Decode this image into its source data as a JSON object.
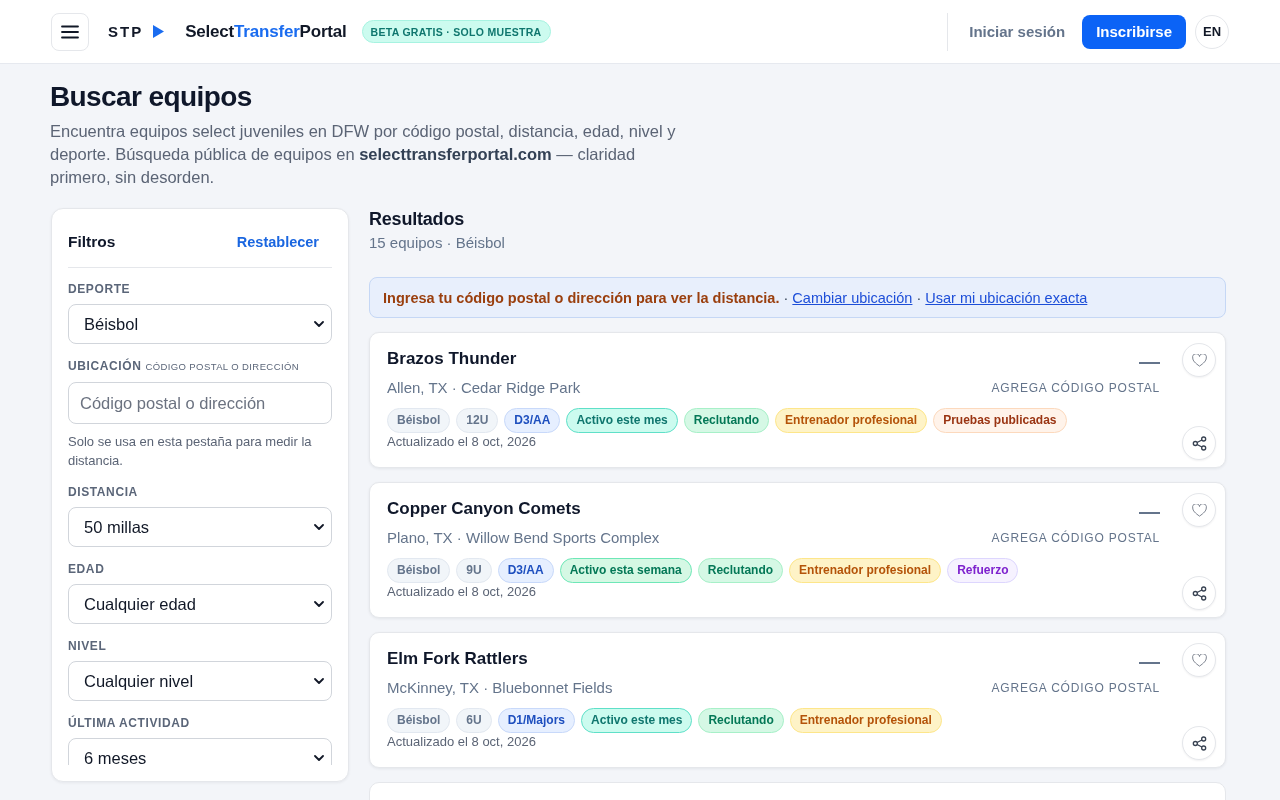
{
  "header": {
    "brand": {
      "abbr": "STP",
      "name_parts": [
        {
          "text": "Select",
          "accent": false
        },
        {
          "text": "Transfer",
          "accent": true
        },
        {
          "text": "Portal",
          "accent": false
        }
      ]
    },
    "badge": "BETA GRATIS · SOLO MUESTRA",
    "sign_in": "Iniciar sesión",
    "sign_up": "Inscribirse",
    "language": "EN"
  },
  "page": {
    "title": "Buscar equipos",
    "description": "Encuentra equipos select juveniles en DFW por código postal, distancia, edad, nivel y deporte. Búsqueda pública de equipos en **selecttransferportal.com** — claridad primero, sin desorden."
  },
  "filters": {
    "title": "Filtros",
    "reset": "Restablecer",
    "fields": [
      {
        "kind": "select",
        "label": "DEPORTE",
        "value": "Béisbol"
      },
      {
        "kind": "input",
        "label": "UBICACIÓN",
        "sublabel": "CÓDIGO POSTAL O DIRECCIÓN",
        "placeholder": "Código postal o dirección",
        "help": "Solo se usa en esta pestaña para medir la distancia."
      },
      {
        "kind": "select",
        "label": "DISTANCIA",
        "value": "50 millas"
      },
      {
        "kind": "select",
        "label": "EDAD",
        "value": "Cualquier edad"
      },
      {
        "kind": "select",
        "label": "NIVEL",
        "value": "Cualquier nivel"
      },
      {
        "kind": "select",
        "label": "ÚLTIMA ACTIVIDAD",
        "value": "6 meses"
      }
    ]
  },
  "results": {
    "title": "Resultados",
    "summary": "15 equipos · Béisbol",
    "notice": {
      "message": "Ingresa tu código postal o dirección para ver la distancia.",
      "separator": "·",
      "links": [
        "Cambiar ubicación",
        "Usar mi ubicación exacta"
      ]
    },
    "cards": [
      {
        "name": "Brazos Thunder",
        "location": "Allen, TX · Cedar Ridge Park",
        "distance": "—",
        "distance_note": "AGREGA CÓDIGO POSTAL",
        "saved": false,
        "tags": [
          {
            "label": "Béisbol",
            "kind": "sport"
          },
          {
            "label": "12U",
            "kind": "age"
          },
          {
            "label": "D3/AA",
            "kind": "level"
          },
          {
            "label": "Activo este mes",
            "kind": "active-month"
          },
          {
            "label": "Reclutando",
            "kind": "recruiting"
          },
          {
            "label": "Entrenador profesional",
            "kind": "coach"
          },
          {
            "label": "Pruebas publicadas",
            "kind": "tryouts"
          }
        ],
        "updated": "Actualizado el 8 oct, 2026"
      },
      {
        "name": "Copper Canyon Comets",
        "location": "Plano, TX · Willow Bend Sports Complex",
        "distance": "—",
        "distance_note": "AGREGA CÓDIGO POSTAL",
        "saved": false,
        "tags": [
          {
            "label": "Béisbol",
            "kind": "sport"
          },
          {
            "label": "9U",
            "kind": "age"
          },
          {
            "label": "D3/AA",
            "kind": "level"
          },
          {
            "label": "Activo esta semana",
            "kind": "active-week"
          },
          {
            "label": "Reclutando",
            "kind": "recruiting"
          },
          {
            "label": "Entrenador profesional",
            "kind": "coach"
          },
          {
            "label": "Refuerzo",
            "kind": "guest"
          }
        ],
        "updated": "Actualizado el 8 oct, 2026"
      },
      {
        "name": "Elm Fork Rattlers",
        "location": "McKinney, TX · Bluebonnet Fields",
        "distance": "—",
        "distance_note": "AGREGA CÓDIGO POSTAL",
        "saved": false,
        "tags": [
          {
            "label": "Béisbol",
            "kind": "sport"
          },
          {
            "label": "6U",
            "kind": "age"
          },
          {
            "label": "D1/Majors",
            "kind": "level"
          },
          {
            "label": "Activo este mes",
            "kind": "active-month"
          },
          {
            "label": "Reclutando",
            "kind": "recruiting"
          },
          {
            "label": "Entrenador profesional",
            "kind": "coach"
          }
        ],
        "updated": "Actualizado el 8 oct, 2026"
      }
    ]
  }
}
